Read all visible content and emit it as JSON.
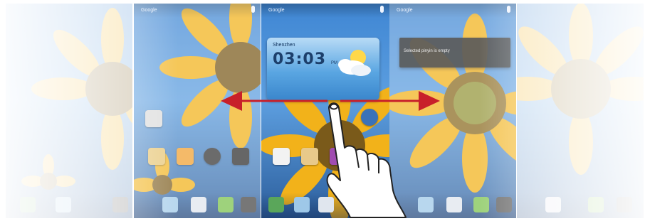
{
  "screens": [
    {
      "search_label": "",
      "has_mic": false
    },
    {
      "search_label": "Google",
      "has_mic": true
    },
    {
      "search_label": "Google",
      "has_mic": true
    },
    {
      "search_label": "Google",
      "has_mic": true
    },
    {
      "search_label": "",
      "has_mic": false
    }
  ],
  "clock_widget": {
    "location": "Shenzhen",
    "time": "03:03",
    "ampm": "PM",
    "date": ""
  },
  "popup": {
    "text": "Selected pinyin is empty"
  },
  "icons": {
    "swipe_left_arrow": "arrow-left-icon",
    "swipe_right_arrow": "arrow-right-icon",
    "hand": "pointing-hand-icon",
    "weather": "partly-cloudy-icon",
    "mic": "microphone-icon"
  },
  "colors": {
    "arrow": "#c8202a",
    "sky": "#4d93db",
    "petal": "#f2b21a",
    "flower_center": "#7a5a1a"
  }
}
